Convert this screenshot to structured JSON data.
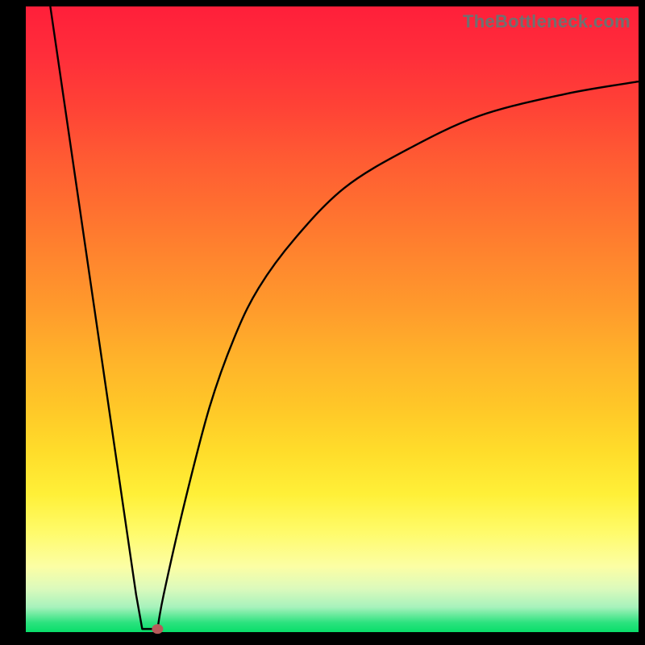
{
  "attribution": "TheBottleneck.com",
  "chart_data": {
    "type": "line",
    "title": "",
    "xlabel": "",
    "ylabel": "",
    "x_range": [
      0,
      100
    ],
    "y_range": [
      0,
      100
    ],
    "curve": [
      {
        "x": 4.0,
        "y": 100.0
      },
      {
        "x": 18.0,
        "y": 6.0
      },
      {
        "x": 19.0,
        "y": 0.5
      },
      {
        "x": 21.5,
        "y": 0.5
      },
      {
        "x": 22.5,
        "y": 6.0
      },
      {
        "x": 26.0,
        "y": 21.0
      },
      {
        "x": 30.0,
        "y": 36.0
      },
      {
        "x": 34.0,
        "y": 47.0
      },
      {
        "x": 38.0,
        "y": 55.0
      },
      {
        "x": 44.0,
        "y": 63.0
      },
      {
        "x": 52.0,
        "y": 71.0
      },
      {
        "x": 62.0,
        "y": 77.0
      },
      {
        "x": 74.0,
        "y": 82.5
      },
      {
        "x": 88.0,
        "y": 86.0
      },
      {
        "x": 100.0,
        "y": 88.0
      }
    ],
    "flat_bottom": {
      "x_start": 19.0,
      "x_end": 21.5,
      "y": 0.5
    },
    "marker": {
      "x": 21.5,
      "y": 0.5,
      "color": "#b85a5a"
    }
  }
}
